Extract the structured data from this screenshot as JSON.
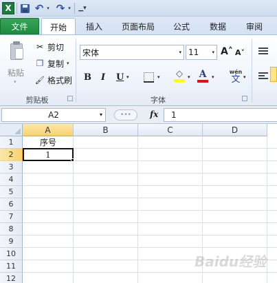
{
  "app": {
    "logo": "X"
  },
  "quick_access": {
    "undo_glyph": "↶",
    "redo_glyph": "↷",
    "dropdown_glyph": "▾",
    "customize_glyph": "▁▾"
  },
  "tabs": [
    {
      "label": "文件"
    },
    {
      "label": "开始"
    },
    {
      "label": "插入"
    },
    {
      "label": "页面布局"
    },
    {
      "label": "公式"
    },
    {
      "label": "数据"
    },
    {
      "label": "审阅"
    }
  ],
  "clipboard": {
    "paste_label": "粘贴",
    "cut_label": "剪切",
    "copy_label": "复制",
    "format_painter_label": "格式刷",
    "group_label": "剪贴板",
    "cut_glyph": "✂",
    "copy_glyph": "❐",
    "format_glyph": "🖌"
  },
  "font": {
    "name": "宋体",
    "size": "11",
    "group_label": "字体",
    "grow_glyph": "A˄",
    "shrink_glyph": "A˅",
    "bold_glyph": "B",
    "italic_glyph": "I",
    "underline_glyph": "U",
    "fill_glyph": "◇",
    "color_glyph": "A",
    "phonetic_top": "wén",
    "phonetic_bottom": "文"
  },
  "formula_bar": {
    "name_box": "A2",
    "dots": "•••",
    "fx": "fx",
    "value": "1"
  },
  "grid": {
    "columns": [
      "A",
      "B",
      "C",
      "D"
    ],
    "rows": [
      "1",
      "2",
      "3",
      "4",
      "5",
      "6",
      "7",
      "8",
      "9",
      "10",
      "11",
      "12"
    ],
    "selected_column": "A",
    "selected_row": "2",
    "cells": {
      "A1": "序号",
      "A2": "1"
    }
  },
  "colors": {
    "file_tab": "#1f8a3f",
    "selection_header": "#f7d26d",
    "fill_color": "#ffff00",
    "font_color": "#e0101a"
  },
  "watermark": "Baidu经验"
}
